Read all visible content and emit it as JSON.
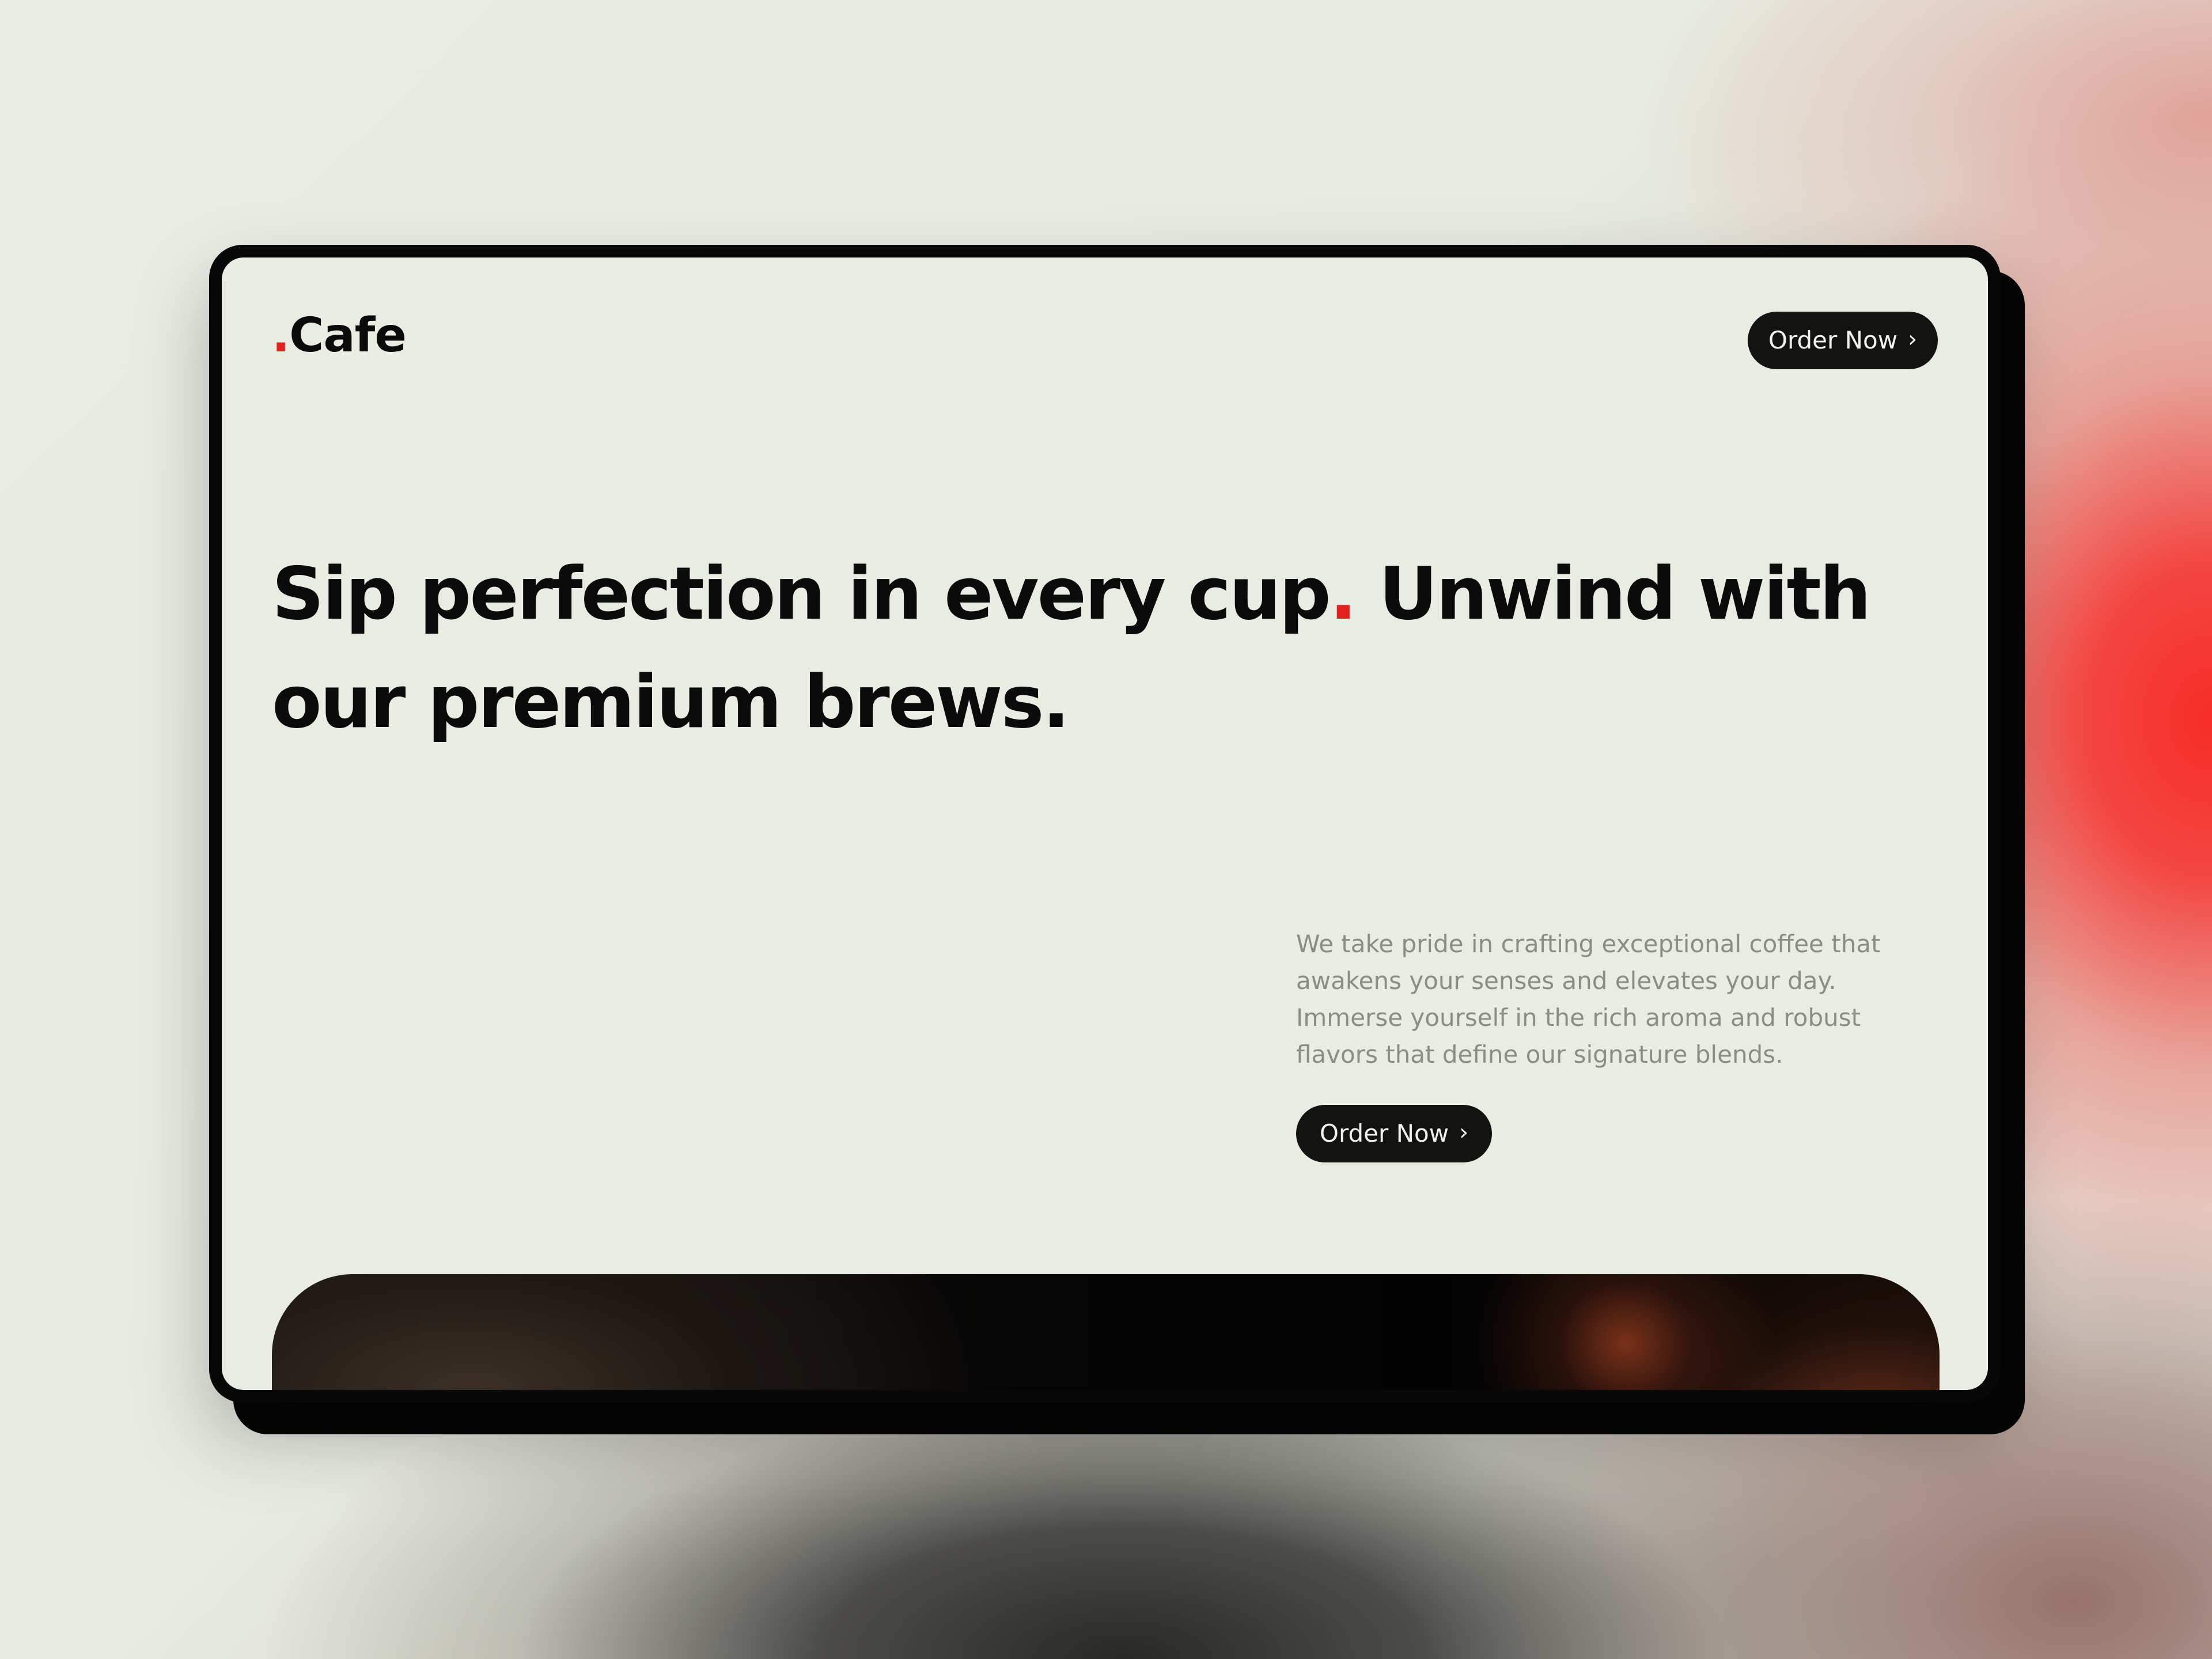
{
  "brand": {
    "dot": ".",
    "name": "Cafe"
  },
  "header": {
    "order_button_label": "Order Now",
    "order_button_icon": "chevron-right-icon"
  },
  "hero": {
    "headline_part1": "Sip perfection in every cup",
    "headline_dot": ".",
    "headline_part2": " Unwind with our premium brews.",
    "description": "We take pride in crafting exceptional coffee that awakens your senses and elevates your day. Immerse yourself in the rich aroma and robust flavors that define our signature blends.",
    "cta_label": "Order Now",
    "cta_icon": "chevron-right-icon"
  },
  "colors": {
    "accent": "#e3211c",
    "text": "#0b0b0b",
    "button_bg": "#131411",
    "page_bg": "#e8ece2",
    "muted_text": "#8a8d86"
  }
}
